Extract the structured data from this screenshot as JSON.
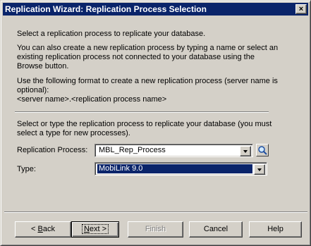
{
  "window": {
    "title": "Replication Wizard: Replication Process Selection",
    "close_glyph": "×"
  },
  "intro": {
    "line1": "Select a replication process to replicate your database.",
    "para2": "You can also create a new replication process by typing a name or select an existing replication process not connected to your database using the Browse button.",
    "para3": "Use the following format to create a new replication process (server name is optional):",
    "format": "<server name>.<replication process name>"
  },
  "form": {
    "instructions": "Select or type the replication process to replicate your database (you must select a type for new processes).",
    "replication_process_label": "Replication Process:",
    "replication_process_value": "MBL_Rep_Process",
    "type_label": "Type:",
    "type_value": "MobiLink 9.0"
  },
  "buttons": {
    "back": {
      "mnemonic": "B",
      "rest": "ack",
      "prefix": "< "
    },
    "next": {
      "mnemonic": "N",
      "rest": "ext >"
    },
    "finish": "Finish",
    "cancel": "Cancel",
    "help": "Help"
  }
}
